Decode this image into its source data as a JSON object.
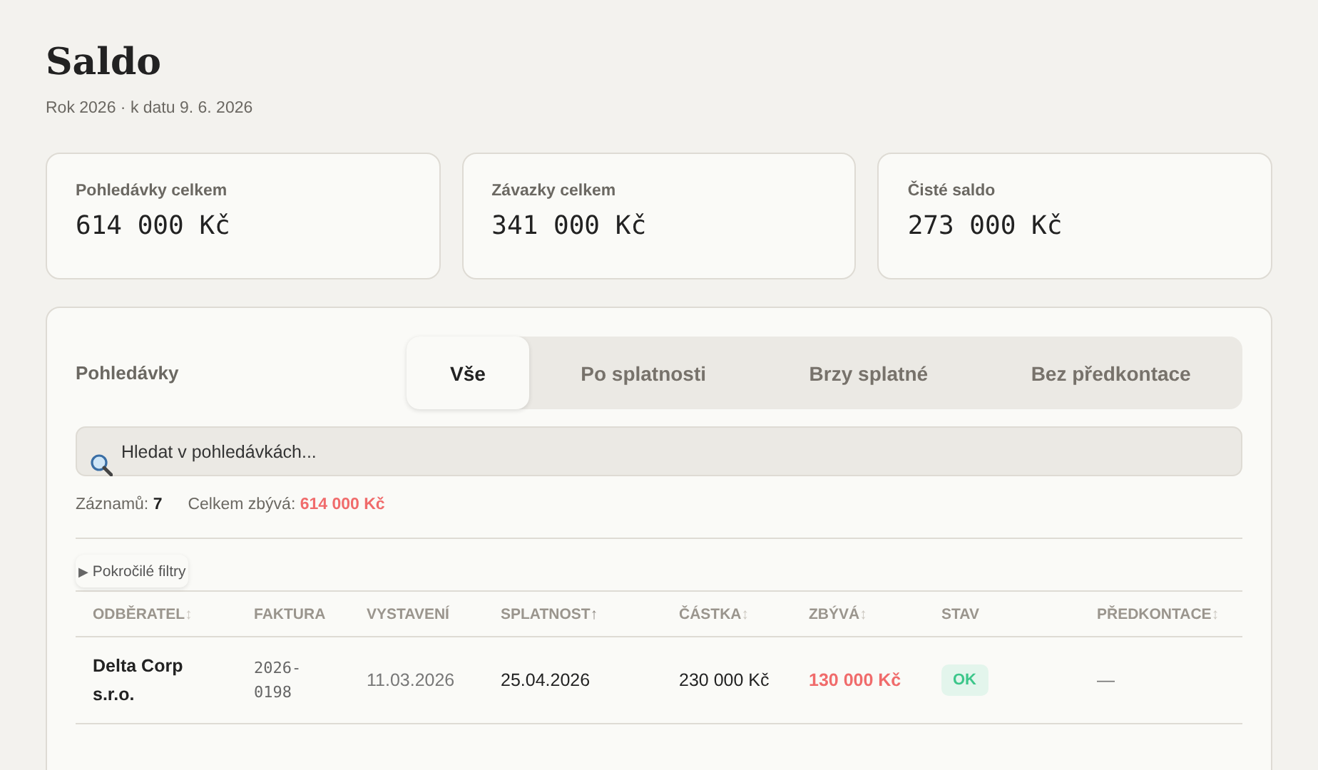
{
  "header": {
    "title": "Saldo",
    "subtitle": "Rok 2026 · k datu 9. 6. 2026"
  },
  "summary_cards": [
    {
      "label": "Pohledávky celkem",
      "value": "614 000 Kč"
    },
    {
      "label": "Závazky celkem",
      "value": "341 000 Kč"
    },
    {
      "label": "Čisté saldo",
      "value": "273 000 Kč"
    }
  ],
  "panel": {
    "title": "Pohledávky",
    "tabs": [
      {
        "label": "Vše",
        "selected": true
      },
      {
        "label": "Po splatnosti",
        "selected": false
      },
      {
        "label": "Brzy splatné",
        "selected": false
      },
      {
        "label": "Bez předkontace",
        "selected": false
      }
    ],
    "search": {
      "placeholder": "Hledat v pohledávkách..."
    },
    "stats": [
      {
        "label": "Záznamů:",
        "value": "7",
        "kind": "count"
      },
      {
        "label": "Celkem zbývá:",
        "value": "614 000 Kč",
        "kind": "amount"
      }
    ],
    "filters_toggle": {
      "icon": "▶",
      "label": "Pokročilé filtry"
    },
    "table": {
      "columns": [
        {
          "label": "ODBĚRATEL",
          "sort_icon": "↕",
          "sorted": false
        },
        {
          "label": "FAKTURA"
        },
        {
          "label": "VYSTAVENÍ"
        },
        {
          "label": "SPLATNOST",
          "sort_icon": "↑",
          "sorted": true
        },
        {
          "label": "ČÁSTKA",
          "sort_icon": "↕",
          "sorted": false
        },
        {
          "label": "ZBÝVÁ",
          "sort_icon": "↕",
          "sorted": false
        },
        {
          "label": "STAV"
        },
        {
          "label": "PŘEDKONTACE",
          "sort_icon": "↕",
          "sorted": false
        }
      ],
      "rows": [
        {
          "customer": "Delta Corp s.r.o.",
          "invoice": "2026-0198",
          "issued": "11.03.2026",
          "due": "25.04.2026",
          "amount": "230 000 Kč",
          "remaining": "130 000 Kč",
          "status": {
            "label": "OK",
            "kind": "ok"
          },
          "precontact": "—"
        }
      ]
    }
  }
}
